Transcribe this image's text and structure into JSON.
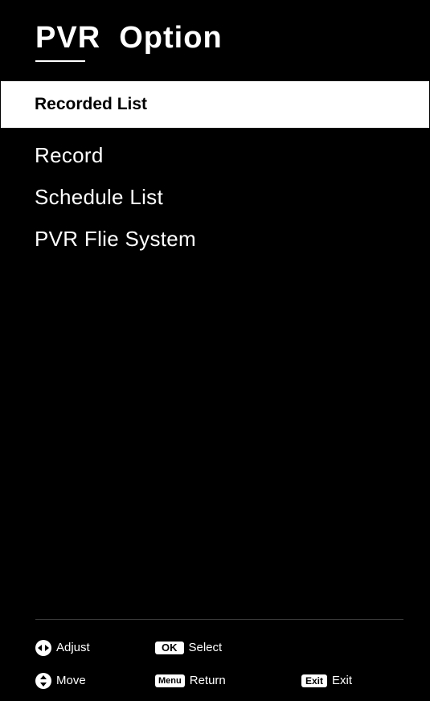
{
  "header": {
    "title": "PVR  Option"
  },
  "menu": {
    "selected_label": "Recorded List",
    "items": [
      {
        "label": "Record"
      },
      {
        "label": "Schedule List"
      },
      {
        "label": "PVR Flie System"
      }
    ]
  },
  "hints": {
    "adjust": {
      "icon": "left-right-arrows-icon",
      "label": "Adjust"
    },
    "select": {
      "key": "OK",
      "label": "Select"
    },
    "move": {
      "icon": "up-down-arrows-icon",
      "label": "Move"
    },
    "return": {
      "key": "Menu",
      "label": "Return"
    },
    "exit": {
      "key": "Exit",
      "label": "Exit"
    }
  },
  "colors": {
    "background": "#000000",
    "text": "#ffffff",
    "highlight": "#ffffff",
    "highlight_text": "#000000"
  }
}
